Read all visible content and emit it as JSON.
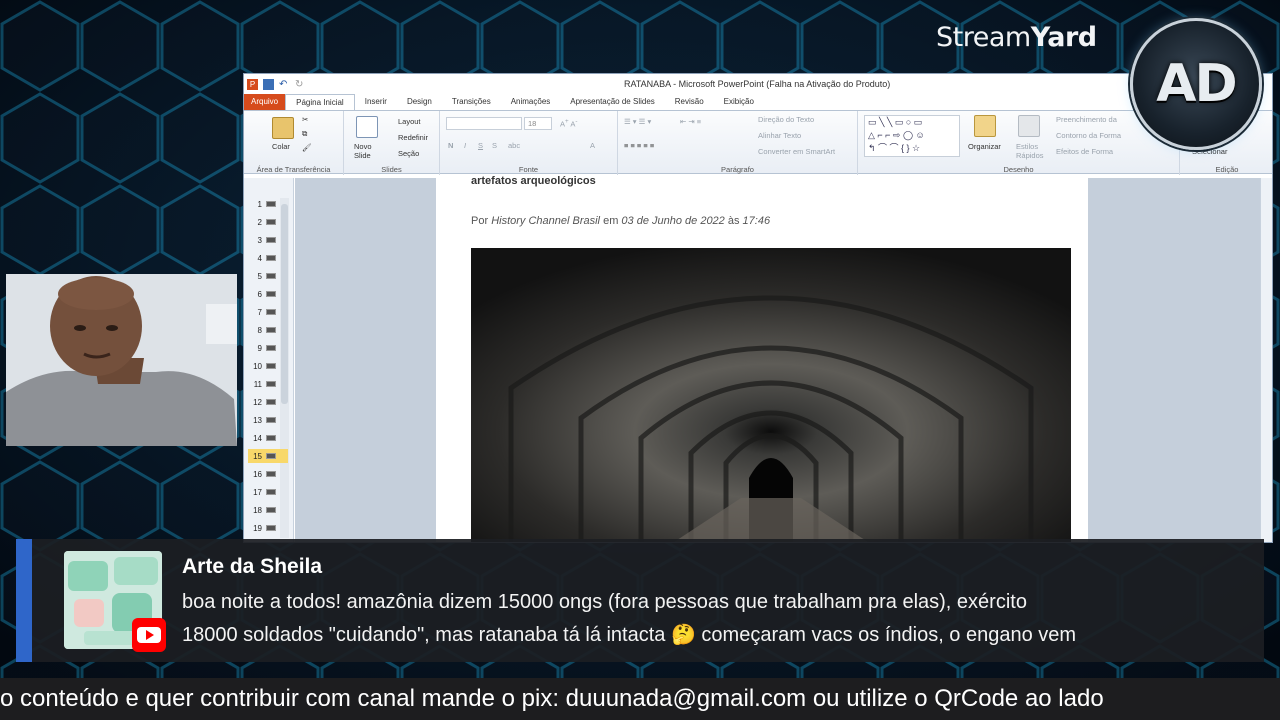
{
  "stream": {
    "brand_light": "Stream",
    "brand_bold": "Yard",
    "badge_text": "AD"
  },
  "powerpoint": {
    "window_title": "RATANABA - Microsoft PowerPoint (Falha na Ativação do Produto)",
    "tabs": [
      {
        "label": "Arquivo"
      },
      {
        "label": "Página Inicial"
      },
      {
        "label": "Inserir"
      },
      {
        "label": "Design"
      },
      {
        "label": "Transições"
      },
      {
        "label": "Animações"
      },
      {
        "label": "Apresentação de Slides"
      },
      {
        "label": "Revisão"
      },
      {
        "label": "Exibição"
      }
    ],
    "ribbon": {
      "clipboard_group": "Área de Transferência",
      "paste_label": "Colar",
      "slides_group": "Slides",
      "new_slide_label": "Novo Slide",
      "layout_label": "Layout",
      "reset_label": "Redefinir",
      "section_label": "Seção",
      "font_group": "Fonte",
      "font_size": "18",
      "paragraph_group": "Parágrafo",
      "text_direction": "Direção do Texto",
      "align_text": "Alinhar Texto",
      "smartart": "Converter em SmartArt",
      "drawing_group": "Desenho",
      "arrange_label": "Organizar",
      "quick_styles_label": "Estilos Rápidos",
      "shape_fill": "Preenchimento da",
      "shape_outline": "Contorno da Forma",
      "shape_effects": "Efeitos de Forma",
      "editing_group": "Edição",
      "select_label": "Selecionar"
    },
    "slide_numbers": [
      "1",
      "2",
      "3",
      "4",
      "5",
      "6",
      "7",
      "8",
      "9",
      "10",
      "11",
      "12",
      "13",
      "14",
      "15",
      "16",
      "17",
      "18",
      "19"
    ],
    "selected_slide": "15",
    "slide": {
      "heading": "artefatos arqueológicos",
      "byline_prefix": "Por ",
      "byline_author": "History Channel Brasil",
      "byline_mid": " em ",
      "byline_date": "03 de Junho de 2022",
      "byline_at": " às ",
      "byline_time": "17:46"
    }
  },
  "comment": {
    "author": "Arte da Sheila",
    "line1": "boa noite a todos! amazônia dizem 15000 ongs (fora pessoas que trabalham pra elas), exército",
    "line2": "18000 soldados \"cuidando\", mas ratanaba tá lá intacta 🤔 começaram vacs os índios, o engano vem",
    "platform_icon": "youtube-icon"
  },
  "ticker": {
    "text": "o conteúdo e quer contribuir com canal mande o pix: duuunada@gmail.com ou utilize o QrCode ao lado"
  },
  "colors": {
    "banner_accent": "#2f66c9",
    "ppt_file_tab": "#d64b1c",
    "hex_glow": "#1ec8ff"
  }
}
